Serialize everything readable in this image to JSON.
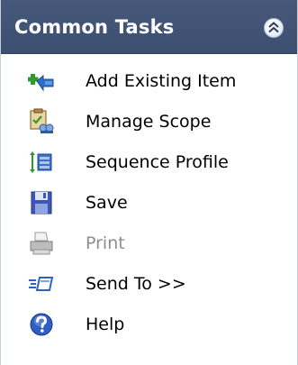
{
  "header": {
    "title": "Common Tasks",
    "collapse_icon": "double-chevron-up-icon"
  },
  "tasks": [
    {
      "label": "Add Existing Item",
      "icon": "add-existing-item-icon",
      "enabled": true
    },
    {
      "label": "Manage Scope",
      "icon": "manage-scope-icon",
      "enabled": true
    },
    {
      "label": "Sequence Profile",
      "icon": "sequence-profile-icon",
      "enabled": true
    },
    {
      "label": "Save",
      "icon": "floppy-disk-icon",
      "enabled": true
    },
    {
      "label": "Print",
      "icon": "printer-icon",
      "enabled": false
    },
    {
      "label": "Send To >>",
      "icon": "send-to-icon",
      "enabled": true
    },
    {
      "label": "Help",
      "icon": "help-icon",
      "enabled": true
    }
  ],
  "colors": {
    "header_background": "#3d4f70",
    "header_text": "#ffffff",
    "disabled_text": "#8e8e8e"
  }
}
